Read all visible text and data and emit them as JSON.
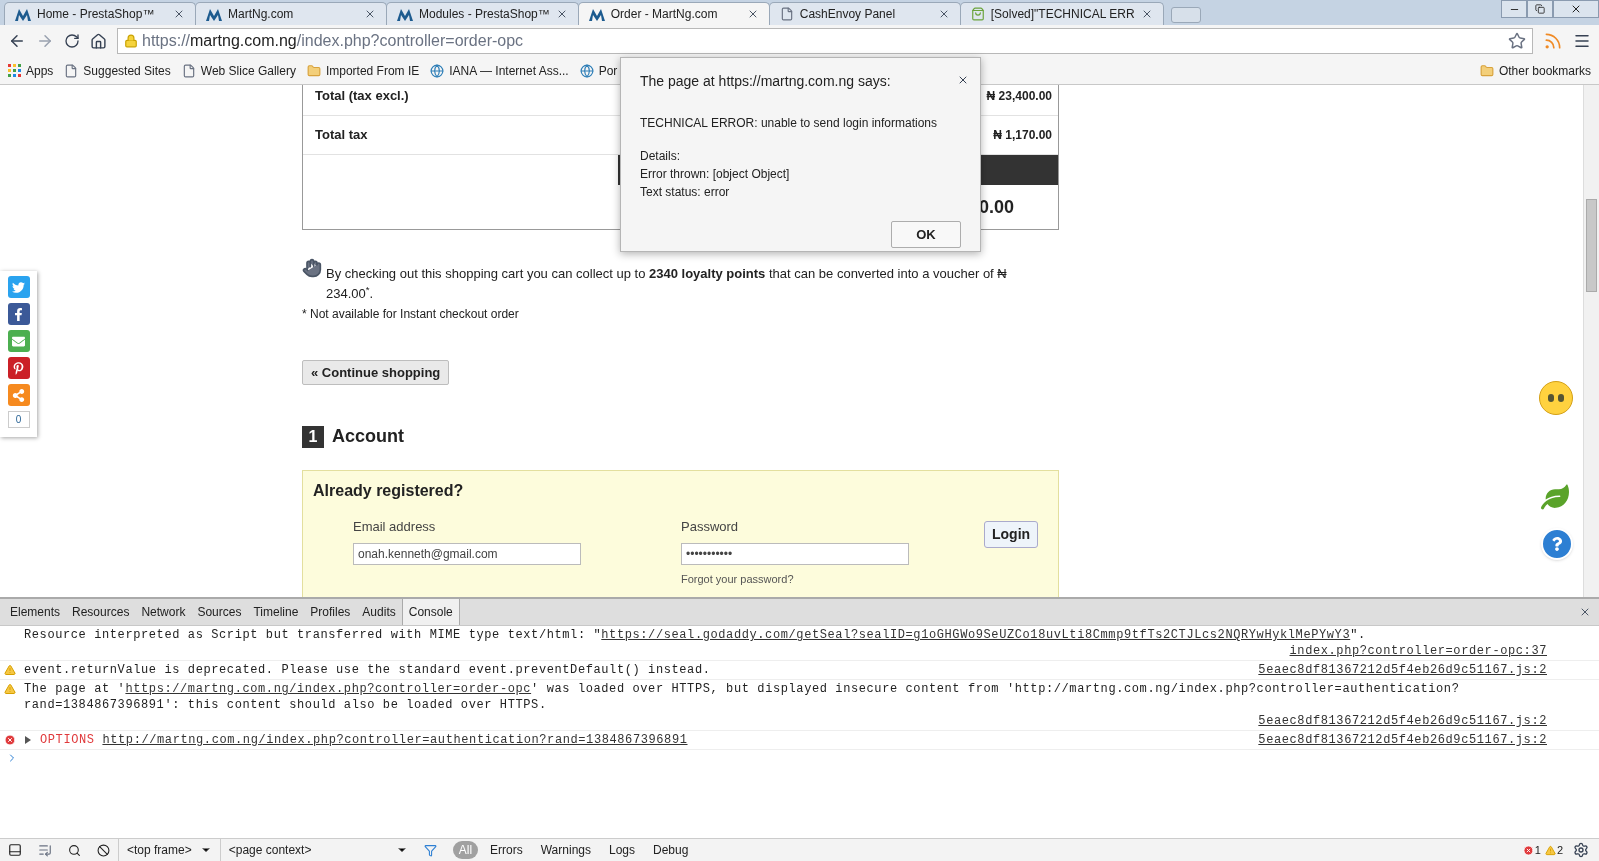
{
  "browser": {
    "tabs": [
      {
        "title": "Home - PrestaShop™",
        "kind": "site",
        "selected": false
      },
      {
        "title": "MartNg.com",
        "kind": "site",
        "selected": false
      },
      {
        "title": "Modules - PrestaShop™",
        "kind": "site",
        "selected": false
      },
      {
        "title": "Order - MartNg.com",
        "kind": "site",
        "selected": true
      },
      {
        "title": "CashEnvoy Panel",
        "kind": "blank",
        "selected": false
      },
      {
        "title": "[Solved]\"TECHNICAL ERR",
        "kind": "forum",
        "selected": false
      }
    ],
    "address": {
      "scheme": "https://",
      "host": "martng.com.ng",
      "path": "/index.php?controller=order-opc"
    },
    "bookmarks": [
      {
        "label": "Apps",
        "kind": "apps"
      },
      {
        "label": "Suggested Sites",
        "kind": "page"
      },
      {
        "label": "Web Slice Gallery",
        "kind": "page"
      },
      {
        "label": "Imported From IE",
        "kind": "folder"
      },
      {
        "label": "IANA — Internet Ass...",
        "kind": "globe"
      },
      {
        "label": "Por",
        "kind": "globe"
      }
    ],
    "other_bookmarks": "Other bookmarks"
  },
  "page": {
    "totals": [
      {
        "label": "Total (tax excl.)",
        "value": "₦ 23,400.00"
      },
      {
        "label": "Total tax",
        "value": "₦ 1,170.00"
      }
    ],
    "total_value": "0.00",
    "loyalty": "By checking out this shopping cart you can collect up to **2340 loyalty points** that can be converted into a voucher of ₦ 234.00$^{*}$.",
    "note": "* Not available for Instant checkout order",
    "continue_button": "« Continue shopping",
    "step": {
      "number": "1",
      "title": "Account"
    },
    "login": {
      "heading": "Already registered?",
      "email_label": "Email address",
      "email_value": "onah.kenneth@gmail.com",
      "password_label": "Password",
      "password_value": "•••••••••••",
      "forgot": "Forgot your password?",
      "button": "Login"
    },
    "share_count": "0"
  },
  "dialog": {
    "title": "The page at https://martng.com.ng says:",
    "message": "TECHNICAL ERROR: unable to send login informations",
    "details": [
      "Details:",
      "Error thrown: [object Object]",
      "Text status: error"
    ],
    "button": "OK"
  },
  "devtools": {
    "tabs": [
      {
        "label": "Elements",
        "selected": false
      },
      {
        "label": "Resources",
        "selected": false
      },
      {
        "label": "Network",
        "selected": false
      },
      {
        "label": "Sources",
        "selected": false
      },
      {
        "label": "Timeline",
        "selected": false
      },
      {
        "label": "Profiles",
        "selected": false
      },
      {
        "label": "Audits",
        "selected": false
      },
      {
        "label": "Console",
        "selected": true
      }
    ],
    "messages": [
      {
        "kind": "log",
        "parts": [
          {
            "kind": "text",
            "text": "Resource interpreted as Script but transferred with MIME type text/html: \""
          },
          {
            "kind": "link",
            "text": "https://seal.godaddy.com/getSeal?sealID=g1oGHGWo9SeUZCo18uvLti8Cmmp9tfTs2CTJLcs2NQRYwHyklMePYwY3"
          },
          {
            "kind": "text",
            "text": "\"."
          }
        ],
        "source": "index.php?controller=order-opc:37"
      },
      {
        "kind": "warning",
        "parts": [
          {
            "kind": "text",
            "text": "event.returnValue is deprecated. Please use the standard event.preventDefault() instead."
          }
        ],
        "source": "5eaec8df81367212d5f4eb26d9c51167.js:2"
      },
      {
        "kind": "warning",
        "parts": [
          {
            "kind": "text",
            "text": "The page at '"
          },
          {
            "kind": "link",
            "text": "https://martng.com.ng/index.php?controller=order-opc"
          },
          {
            "kind": "text",
            "text": "' was loaded over HTTPS, but displayed insecure content from 'http://martng.com.ng/index.php?controller=authentication?rand=1384867396891': this content should also be loaded over HTTPS."
          }
        ],
        "source": "5eaec8df81367212d5f4eb26d9c51167.js:2"
      },
      {
        "kind": "error",
        "expanded": false,
        "method": "OPTIONS",
        "parts": [
          {
            "kind": "link",
            "text": "http://martng.com.ng/index.php?controller=authentication?rand=1384867396891"
          }
        ],
        "source": "5eaec8df81367212d5f4eb26d9c51167.js:2"
      }
    ],
    "frame_select": "<top frame>",
    "context_select": "<page context>",
    "filters": [
      {
        "label": "All",
        "selected": true
      },
      {
        "label": "Errors",
        "selected": false
      },
      {
        "label": "Warnings",
        "selected": false
      },
      {
        "label": "Logs",
        "selected": false
      },
      {
        "label": "Debug",
        "selected": false
      }
    ],
    "error_count": "1",
    "warning_count": "2"
  }
}
